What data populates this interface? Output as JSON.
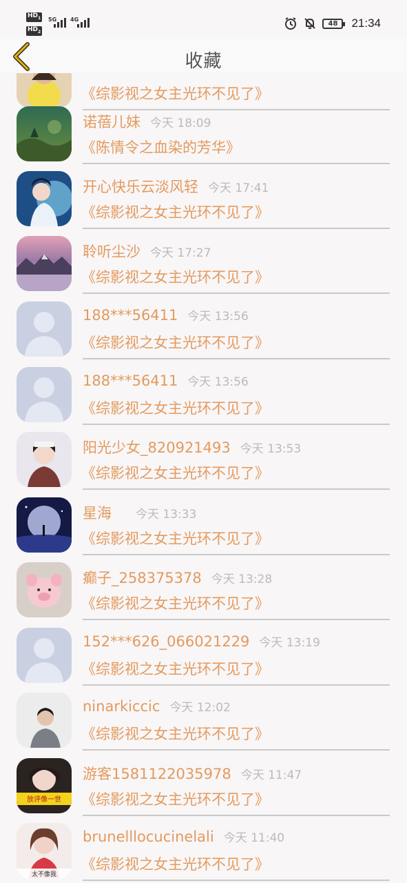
{
  "status_bar": {
    "time": "21:34",
    "battery": "48",
    "sim1": "HD",
    "sim2": "HD",
    "net1": "5G",
    "net2": "4G",
    "sim1_sub": "1",
    "sim2_sub": "2"
  },
  "header": {
    "title": "收藏",
    "back_icon": "chevron-left-icon",
    "accent": "#e8b400"
  },
  "colors": {
    "accent_text": "#e39a5e",
    "time_text": "#bbbbbb",
    "divider": "#c9c9c9"
  },
  "items": [
    {
      "name": "",
      "time": "",
      "book": "《综影视之女主光环不见了》",
      "avatar": "yellow-dress"
    },
    {
      "name": "诺蓓儿妹",
      "time": "今天 18:09",
      "book": "《陈情令之血染的芳华》",
      "avatar": "forest"
    },
    {
      "name": "开心快乐云淡风轻",
      "time": "今天 17:41",
      "book": "《综影视之女主光环不见了》",
      "avatar": "blue-fairy"
    },
    {
      "name": "聆听尘沙",
      "time": "今天 17:27",
      "book": "《综影视之女主光环不见了》",
      "avatar": "mountain"
    },
    {
      "name": "188***56411",
      "time": "今天 13:56",
      "book": "《综影视之女主光环不见了》",
      "avatar": "default"
    },
    {
      "name": "188***56411",
      "time": "今天 13:56",
      "book": "《综影视之女主光环不见了》",
      "avatar": "default"
    },
    {
      "name": "阳光少女_820921493",
      "time": "今天 13:53",
      "book": "《综影视之女主光环不见了》",
      "avatar": "girl"
    },
    {
      "name": "星海 ",
      "time": "今天 13:33",
      "book": "《综影视之女主光环不见了》",
      "avatar": "moon"
    },
    {
      "name": "癫子_258375378",
      "time": "今天 13:28",
      "book": "《综影视之女主光环不见了》",
      "avatar": "pig"
    },
    {
      "name": "152***626_066021229",
      "time": "今天 13:19",
      "book": "《综影视之女主光环不见了》",
      "avatar": "default"
    },
    {
      "name": "ninarkiccic",
      "time": "今天 12:02",
      "book": "《综影视之女主光环不见了》",
      "avatar": "boy"
    },
    {
      "name": "游客1581122035978",
      "time": "今天 11:47",
      "book": "《综影视之女主光环不见了》",
      "avatar": "yellow-sign"
    },
    {
      "name": "brunelllocucinelali",
      "time": "今天 11:40",
      "book": "《综影视之女主光环不见了》",
      "avatar": "red-girl"
    }
  ],
  "avatar_texts": {
    "yellow_sign": "放评像一世",
    "red_girl": "太不像我"
  }
}
